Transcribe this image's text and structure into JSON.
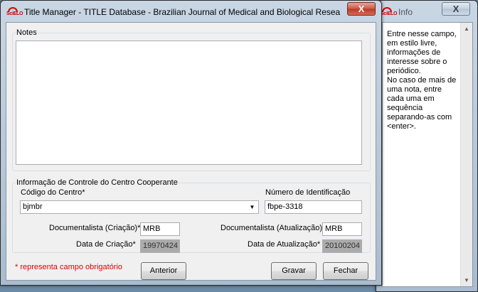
{
  "info_window": {
    "title": "Info",
    "close_label": "X",
    "text": "Entre nesse campo, em estilo livre, informações de interesse sobre o periódico.\nNo caso de mais de uma nota, entre cada uma em sequência separando-as com <enter>."
  },
  "main_window": {
    "app_logo_text": "SciELO",
    "title": "Title Manager - TITLE Database - Brazilian Journal of Medical and Biological Resear...",
    "close_label": "X",
    "notes": {
      "legend": "Notes",
      "value": ""
    },
    "control_info": {
      "legend": "Informação de Controle do Centro Cooperante",
      "center_code_label": "Código do Centro*",
      "center_code_value": "bjmbr",
      "id_number_label": "Número de Identificação",
      "id_number_value": "fbpe-3318",
      "doc_creation_label": "Documentalista (Criação)*",
      "doc_creation_value": "MRB",
      "doc_update_label": "Documentalista (Atualização)*",
      "doc_update_value": "MRB",
      "creation_date_label": "Data de Criação*",
      "creation_date_value": "19970424",
      "update_date_label": "Data de Atualização*",
      "update_date_value": "20100204"
    },
    "required_note": "* representa campo obrigatório",
    "buttons": {
      "previous": "Anterior",
      "save": "Gravar",
      "close": "Fechar"
    }
  }
}
